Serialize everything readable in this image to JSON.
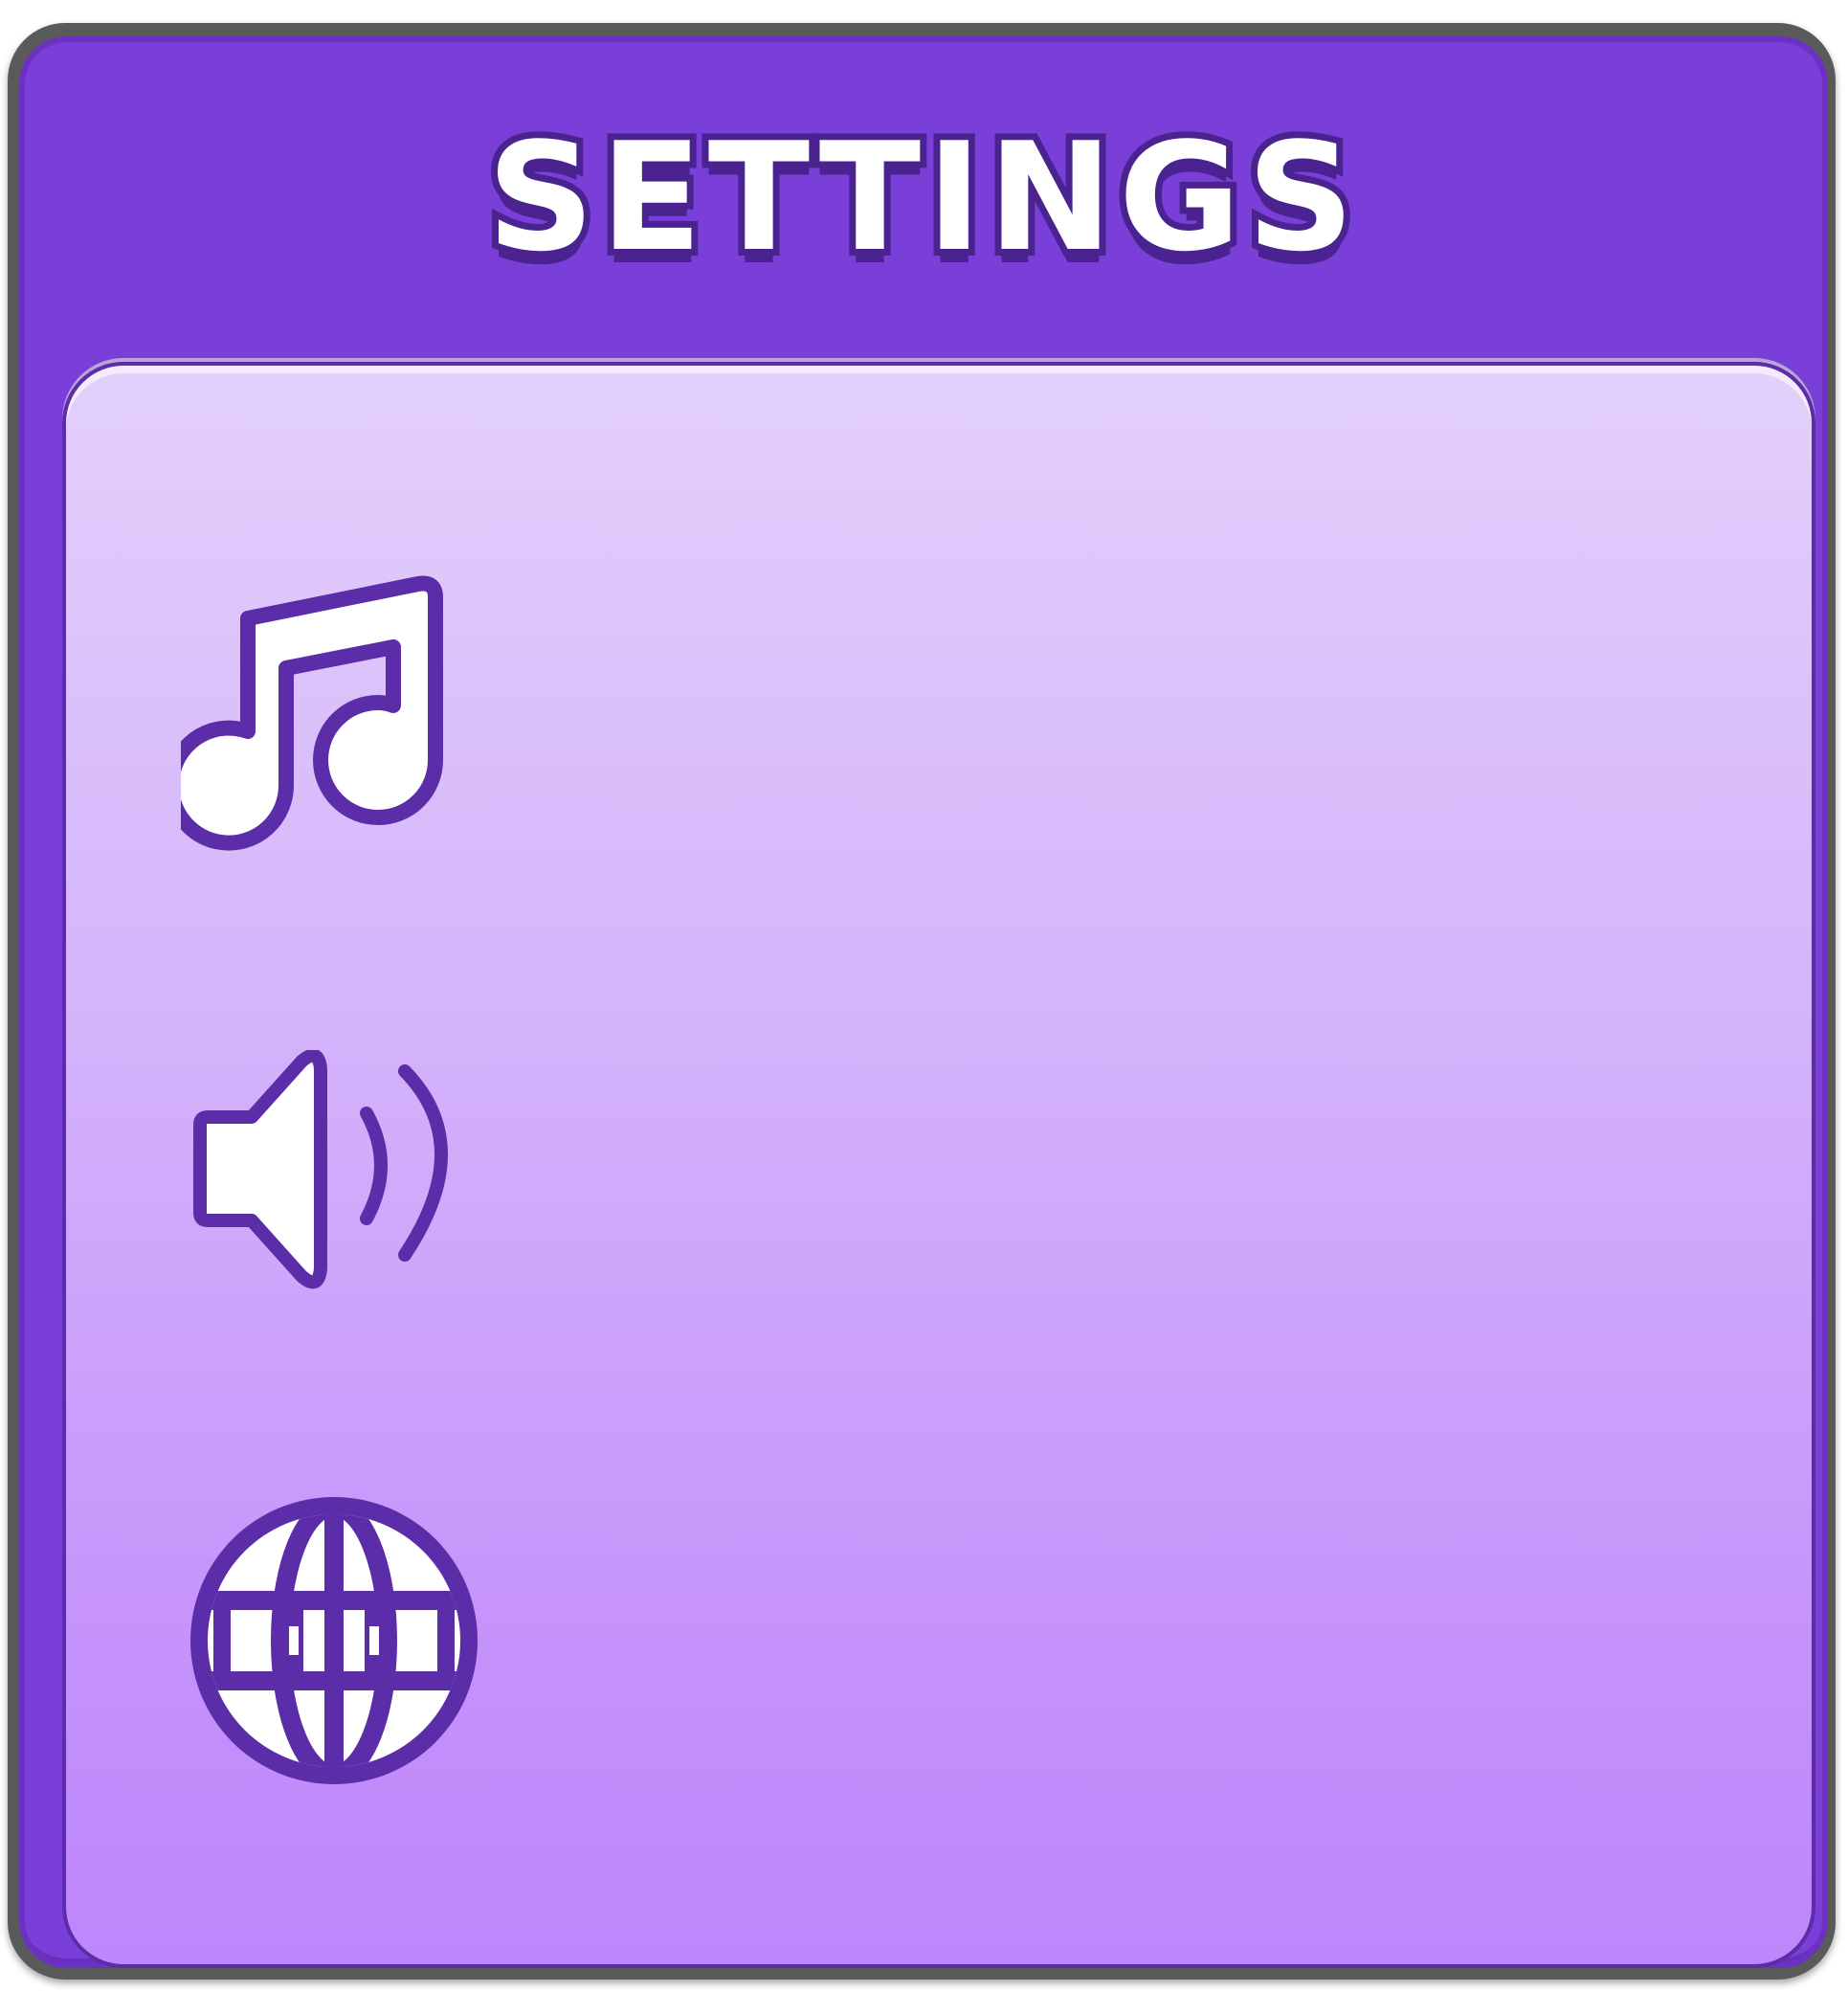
{
  "window": {
    "title": "SETTINGS"
  },
  "settings": [
    {
      "id": "music",
      "icon": "music-note-icon"
    },
    {
      "id": "sound",
      "icon": "speaker-volume-icon"
    },
    {
      "id": "language",
      "icon": "globe-icon"
    }
  ],
  "colors": {
    "panel": "#7b3fd9",
    "panel_border": "#6a31c2",
    "title_text": "#ffffff",
    "title_outline": "#4a2390",
    "content_top": "#e3d0fb",
    "content_bottom": "#bd86fb",
    "icon_fill": "#ffffff",
    "icon_stroke": "#5c2da8"
  }
}
